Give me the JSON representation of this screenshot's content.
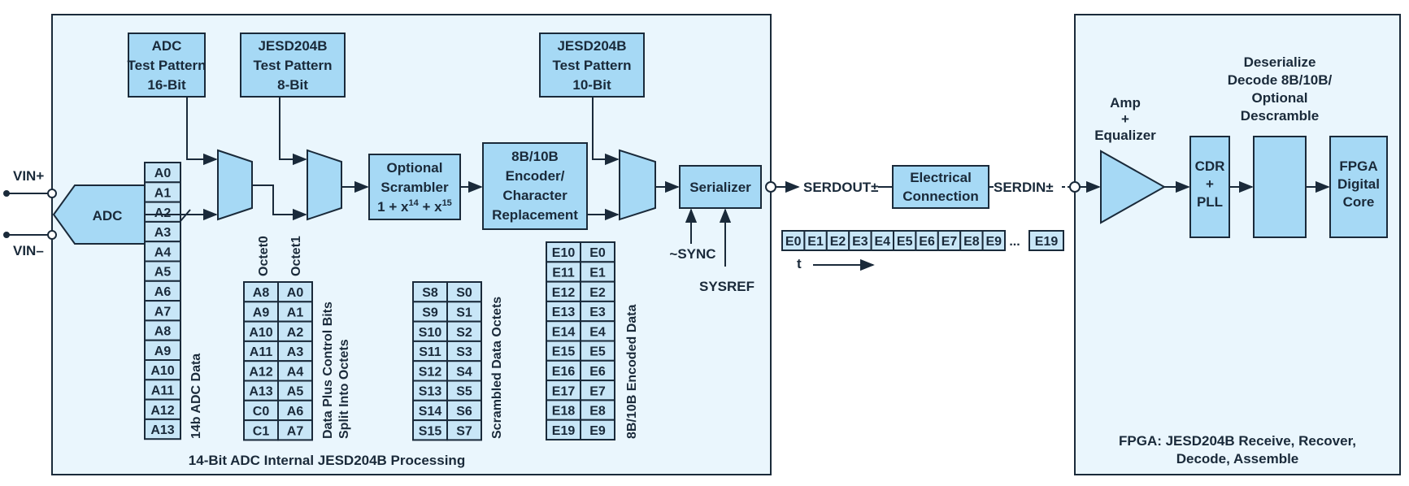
{
  "left_panel": {
    "caption": "14-Bit ADC Internal JESD204B Processing"
  },
  "right_panel": {
    "caption_lines": [
      "FPGA: JESD204B Receive, Recover,",
      "Decode, Assemble"
    ]
  },
  "inputs": {
    "vin_plus": "VIN+",
    "vin_minus": "VIN–"
  },
  "blocks": {
    "adc": "ADC",
    "adc_test_pattern": [
      "ADC",
      "Test Pattern",
      "16-Bit"
    ],
    "jesd_test_pattern_8": [
      "JESD204B",
      "Test Pattern",
      "8-Bit"
    ],
    "jesd_test_pattern_10": [
      "JESD204B",
      "Test Pattern",
      "10-Bit"
    ],
    "scrambler": [
      "Optional",
      "Scrambler"
    ],
    "scrambler_poly": {
      "base": "1 + x",
      "exp1": "14",
      "mid": " + x",
      "exp2": "15"
    },
    "encoder": [
      "8B/10B",
      "Encoder/",
      "Character",
      "Replacement"
    ],
    "serializer": "Serializer",
    "electrical_connection": [
      "Electrical",
      "Connection"
    ],
    "amp_label": [
      "Amp",
      "+",
      "Equalizer"
    ],
    "cdr": [
      "CDR",
      "+",
      "PLL"
    ],
    "deserialize_label": [
      "Deserialize",
      "Decode 8B/10B/",
      "Optional",
      "Descramble"
    ],
    "fpga_core": [
      "FPGA",
      "Digital",
      "Core"
    ]
  },
  "signals": {
    "serdout": "SERDOUT±",
    "serdin": "SERDIN±",
    "sync": "~SYNC",
    "sysref": "SYSREF",
    "time": "t"
  },
  "adc_data": {
    "cells": [
      "A0",
      "A1",
      "A2",
      "A3",
      "A4",
      "A5",
      "A6",
      "A7",
      "A8",
      "A9",
      "A10",
      "A11",
      "A12",
      "A13"
    ],
    "label": "14b ADC Data"
  },
  "octets": {
    "headers": [
      "Octet0",
      "Octet1"
    ],
    "col0": [
      "A8",
      "A9",
      "A10",
      "A11",
      "A12",
      "A13",
      "C0",
      "C1"
    ],
    "col1": [
      "A0",
      "A1",
      "A2",
      "A3",
      "A4",
      "A5",
      "A6",
      "A7"
    ],
    "label_lines": [
      "Data Plus Control Bits",
      "Split Into Octets"
    ]
  },
  "scrambled": {
    "col0": [
      "S8",
      "S9",
      "S10",
      "S11",
      "S12",
      "S13",
      "S14",
      "S15"
    ],
    "col1": [
      "S0",
      "S1",
      "S2",
      "S3",
      "S4",
      "S5",
      "S6",
      "S7"
    ],
    "label": "Scrambled Data Octets"
  },
  "encoded": {
    "col0": [
      "E10",
      "E11",
      "E12",
      "E13",
      "E14",
      "E15",
      "E16",
      "E17",
      "E18",
      "E19"
    ],
    "col1": [
      "E0",
      "E1",
      "E2",
      "E3",
      "E4",
      "E5",
      "E6",
      "E7",
      "E8",
      "E9"
    ],
    "label": "8B/10B Encoded Data"
  },
  "serial_stream": {
    "cells": [
      "E0",
      "E1",
      "E2",
      "E3",
      "E4",
      "E5",
      "E6",
      "E7",
      "E8",
      "E9"
    ],
    "ellipsis": "...",
    "last": "E19"
  }
}
